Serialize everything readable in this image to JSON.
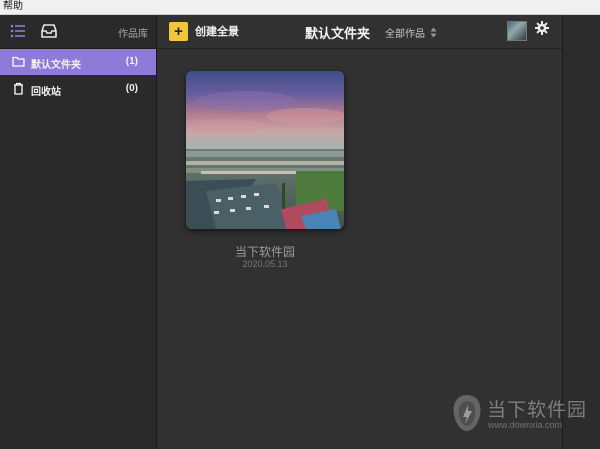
{
  "menubar": {
    "help": "帮助"
  },
  "sidebar": {
    "library_label": "作品库",
    "folders": [
      {
        "name": "默认文件夹",
        "count": "(1)",
        "active": true,
        "icon": "folder-icon"
      },
      {
        "name": "回收站",
        "count": "(0)",
        "active": false,
        "icon": "trash-icon"
      }
    ]
  },
  "toolbar": {
    "create_label": "创建全景",
    "folder_title": "默认文件夹",
    "filter_label": "全部作品"
  },
  "works": [
    {
      "title": "当下软件园",
      "date": "2020.05.13"
    }
  ],
  "watermark": {
    "brand": "当下软件园",
    "url": "www.downxia.com"
  },
  "colors": {
    "accent": "#8e7ad8",
    "create_button": "#f3c53d",
    "background": "#313132"
  }
}
